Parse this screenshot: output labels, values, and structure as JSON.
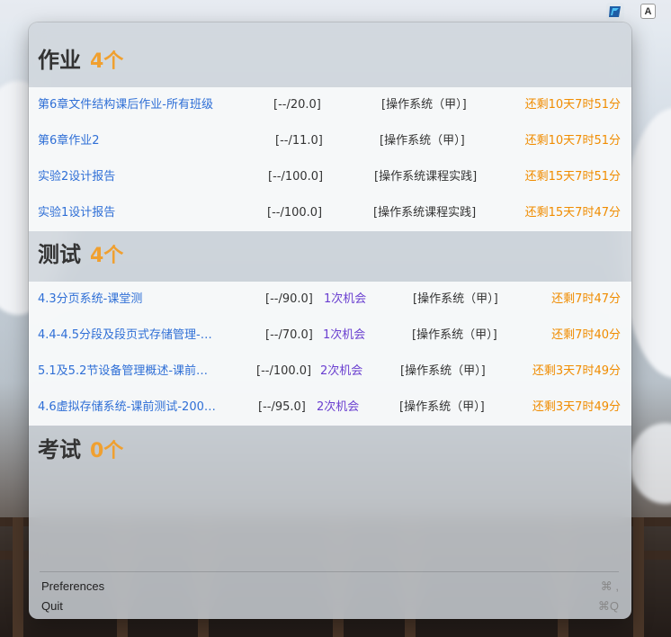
{
  "menubar": {
    "input_indicator": "A"
  },
  "homework": {
    "heading": "作业",
    "count": "4个",
    "items": [
      {
        "title": "第6章文件结构课后作业-所有班级",
        "score": "[--/20.0]",
        "course": "[操作系统（甲）]",
        "remaining": "还剩10天7时51分"
      },
      {
        "title": "第6章作业2",
        "score": "[--/11.0]",
        "course": "[操作系统（甲）]",
        "remaining": "还剩10天7时51分"
      },
      {
        "title": "实验2设计报告",
        "score": "[--/100.0]",
        "course": "[操作系统课程实践]",
        "remaining": "还剩15天7时51分"
      },
      {
        "title": "实验1设计报告",
        "score": "[--/100.0]",
        "course": "[操作系统课程实践]",
        "remaining": "还剩15天7时47分"
      }
    ]
  },
  "tests": {
    "heading": "测试",
    "count": "4个",
    "items": [
      {
        "title": "4.3分页系统-课堂测",
        "score": "[--/90.0]",
        "chances": "1次机会",
        "course": "[操作系统（甲）]",
        "remaining": "还剩7时47分"
      },
      {
        "title": "4.4-4.5分段及段页式存储管理-…",
        "score": "[--/70.0]",
        "chances": "1次机会",
        "course": "[操作系统（甲）]",
        "remaining": "还剩7时40分"
      },
      {
        "title": "5.1及5.2节设备管理概述-课前…",
        "score": "[--/100.0]",
        "chances": "2次机会",
        "course": "[操作系统（甲）]",
        "remaining": "还剩3天7时49分"
      },
      {
        "title": "4.6虚拟存储系统-课前测试-200…",
        "score": "[--/95.0]",
        "chances": "2次机会",
        "course": "[操作系统（甲）]",
        "remaining": "还剩3天7时49分"
      }
    ]
  },
  "exams": {
    "heading": "考试",
    "count": "0个"
  },
  "menu": {
    "preferences_label": "Preferences",
    "preferences_shortcut": "⌘ ,",
    "quit_label": "Quit",
    "quit_shortcut": "⌘Q"
  },
  "colors": {
    "accent_orange": "#f08c00",
    "title_blue": "#2f6fd6",
    "chance_purple": "#6a3fd0"
  }
}
